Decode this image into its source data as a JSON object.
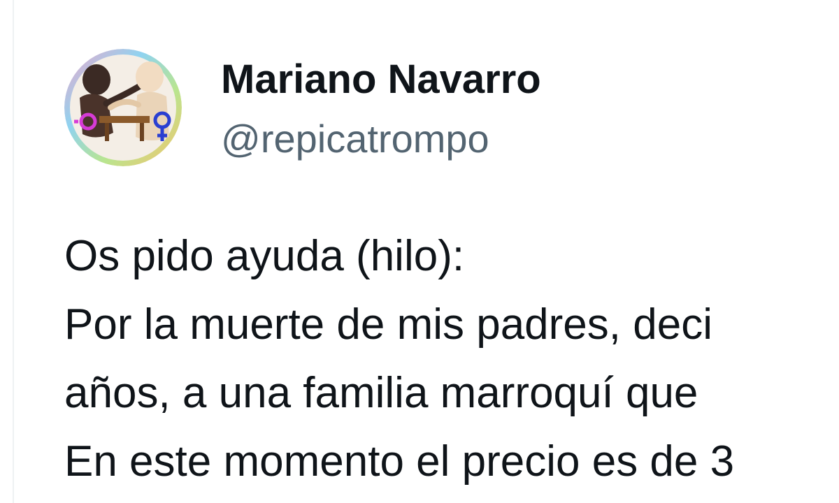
{
  "tweet": {
    "author": {
      "display_name": "Mariano Navarro",
      "handle": "@repicatrompo",
      "avatar_icon": "avatar-image"
    },
    "lines": [
      "Os pido ayuda (hilo):",
      "Por la muerte de mis padres, deci",
      "años, a una familia marroquí que",
      "En este momento el precio es de 3"
    ]
  },
  "colors": {
    "text_primary": "#0f1419",
    "text_secondary": "#536471",
    "background": "#ffffff",
    "border": "#eef1f3"
  }
}
